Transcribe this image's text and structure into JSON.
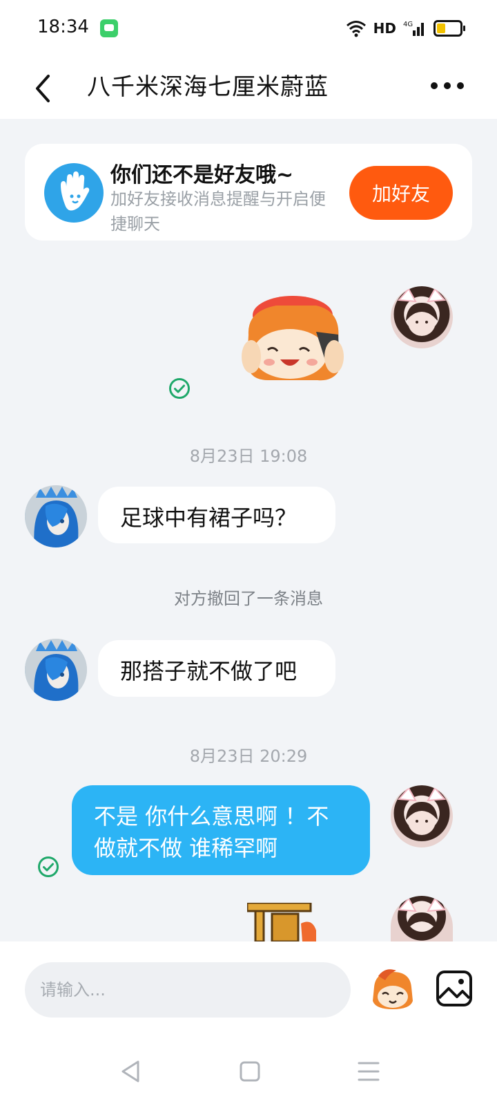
{
  "status_bar": {
    "time": "18:34",
    "network_label": "HD",
    "cellular_label": "4G"
  },
  "header": {
    "title": "八千米深海七厘米蔚蓝"
  },
  "friend_card": {
    "title": "你们还不是好友哦~",
    "description": "加好友接收消息提醒与开启便捷聊天",
    "button_label": "加好友"
  },
  "messages": [
    {
      "type": "sticker",
      "direction": "outgoing",
      "sent": true
    },
    {
      "type": "timestamp",
      "text": "8月23日 19:08"
    },
    {
      "type": "text",
      "direction": "incoming",
      "text": "足球中有裙子吗？"
    },
    {
      "type": "system",
      "text": "对方撤回了一条消息"
    },
    {
      "type": "text",
      "direction": "incoming",
      "text": "那搭子就不做了吧"
    },
    {
      "type": "timestamp",
      "text": "8月23日 20:29"
    },
    {
      "type": "text",
      "direction": "outgoing",
      "text": "不是 你什么意思啊 ！不做就不做 谁稀罕啊",
      "sent": true
    },
    {
      "type": "sticker",
      "direction": "outgoing",
      "partially_visible": true
    }
  ],
  "input": {
    "placeholder": "请输入..."
  },
  "colors": {
    "accent_orange": "#ff5a0f",
    "bubble_outgoing": "#2cb4f5",
    "background": "#f2f4f7",
    "sent_check": "#1fa86a"
  },
  "icons": {
    "back": "chevron-left-icon",
    "more": "more-dots-icon",
    "wave": "waving-hand-icon",
    "emoji": "sticker-face-icon",
    "image": "image-icon",
    "sent": "check-circle-icon"
  }
}
